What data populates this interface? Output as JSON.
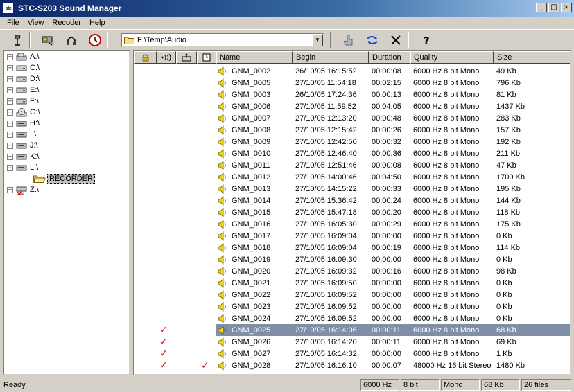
{
  "window": {
    "title": "STC-S203 Sound Manager",
    "icon_text": "stc"
  },
  "menu": [
    "File",
    "View",
    "Recoder",
    "Help"
  ],
  "toolbar": {
    "path": "F:\\Temp\\Audio"
  },
  "tree": [
    {
      "label": "A:\\",
      "icon": "floppy-drive-icon"
    },
    {
      "label": "C:\\",
      "icon": "hard-drive-icon"
    },
    {
      "label": "D:\\",
      "icon": "hard-drive-icon"
    },
    {
      "label": "E:\\",
      "icon": "hard-drive-icon"
    },
    {
      "label": "F:\\",
      "icon": "hard-drive-icon"
    },
    {
      "label": "G:\\",
      "icon": "cd-drive-icon"
    },
    {
      "label": "H:\\",
      "icon": "removable-drive-icon"
    },
    {
      "label": "I:\\",
      "icon": "removable-drive-icon"
    },
    {
      "label": "J:\\",
      "icon": "removable-drive-icon"
    },
    {
      "label": "K:\\",
      "icon": "removable-drive-icon"
    },
    {
      "label": "L:\\",
      "icon": "removable-drive-icon",
      "expanded": true
    },
    {
      "label": "RECORDER",
      "icon": "folder-open-icon",
      "child": true
    },
    {
      "label": "Z:\\",
      "icon": "network-drive-icon"
    }
  ],
  "columns": [
    "",
    "",
    "",
    "",
    "Name",
    "Begin",
    "Duration",
    "Quality",
    "Size"
  ],
  "files": [
    {
      "name": "GNM_0002",
      "begin": "26/10/05  16:15:52",
      "duration": "00:00:08",
      "quality": "6000 Hz 8 bit Mono",
      "size": "49 Kb",
      "c1": "",
      "c4": ""
    },
    {
      "name": "GNM_0005",
      "begin": "27/10/05  11:54:18",
      "duration": "00:02:15",
      "quality": "6000 Hz 8 bit Mono",
      "size": "796 Kb",
      "c1": "",
      "c4": ""
    },
    {
      "name": "GNM_0003",
      "begin": "26/10/05  17:24:36",
      "duration": "00:00:13",
      "quality": "6000 Hz 8 bit Mono",
      "size": "81 Kb",
      "c1": "",
      "c4": ""
    },
    {
      "name": "GNM_0006",
      "begin": "27/10/05  11:59:52",
      "duration": "00:04:05",
      "quality": "6000 Hz 8 bit Mono",
      "size": "1437 Kb",
      "c1": "",
      "c4": ""
    },
    {
      "name": "GNM_0007",
      "begin": "27/10/05  12:13:20",
      "duration": "00:00:48",
      "quality": "6000 Hz 8 bit Mono",
      "size": "283 Kb",
      "c1": "",
      "c4": ""
    },
    {
      "name": "GNM_0008",
      "begin": "27/10/05  12:15:42",
      "duration": "00:00:26",
      "quality": "6000 Hz 8 bit Mono",
      "size": "157 Kb",
      "c1": "",
      "c4": ""
    },
    {
      "name": "GNM_0009",
      "begin": "27/10/05  12:42:50",
      "duration": "00:00:32",
      "quality": "6000 Hz 8 bit Mono",
      "size": "192 Kb",
      "c1": "",
      "c4": ""
    },
    {
      "name": "GNM_0010",
      "begin": "27/10/05  12:46:40",
      "duration": "00:00:36",
      "quality": "6000 Hz 8 bit Mono",
      "size": "211 Kb",
      "c1": "",
      "c4": ""
    },
    {
      "name": "GNM_0011",
      "begin": "27/10/05  12:51:46",
      "duration": "00:00:08",
      "quality": "6000 Hz 8 bit Mono",
      "size": "47 Kb",
      "c1": "",
      "c4": ""
    },
    {
      "name": "GNM_0012",
      "begin": "27/10/05  14:00:46",
      "duration": "00:04:50",
      "quality": "6000 Hz 8 bit Mono",
      "size": "1700 Kb",
      "c1": "",
      "c4": ""
    },
    {
      "name": "GNM_0013",
      "begin": "27/10/05  14:15:22",
      "duration": "00:00:33",
      "quality": "6000 Hz 8 bit Mono",
      "size": "195 Kb",
      "c1": "",
      "c4": ""
    },
    {
      "name": "GNM_0014",
      "begin": "27/10/05  15:36:42",
      "duration": "00:00:24",
      "quality": "6000 Hz 8 bit Mono",
      "size": "144 Kb",
      "c1": "",
      "c4": ""
    },
    {
      "name": "GNM_0015",
      "begin": "27/10/05  15:47:18",
      "duration": "00:00:20",
      "quality": "6000 Hz 8 bit Mono",
      "size": "118 Kb",
      "c1": "",
      "c4": ""
    },
    {
      "name": "GNM_0016",
      "begin": "27/10/05  16:05:30",
      "duration": "00:00:29",
      "quality": "6000 Hz 8 bit Mono",
      "size": "175 Kb",
      "c1": "",
      "c4": ""
    },
    {
      "name": "GNM_0017",
      "begin": "27/10/05  16:09:04",
      "duration": "00:00:00",
      "quality": "6000 Hz 8 bit Mono",
      "size": "0 Kb",
      "c1": "",
      "c4": ""
    },
    {
      "name": "GNM_0018",
      "begin": "27/10/05  16:09:04",
      "duration": "00:00:19",
      "quality": "6000 Hz 8 bit Mono",
      "size": "114 Kb",
      "c1": "",
      "c4": ""
    },
    {
      "name": "GNM_0019",
      "begin": "27/10/05  16:09:30",
      "duration": "00:00:00",
      "quality": "6000 Hz 8 bit Mono",
      "size": "0 Kb",
      "c1": "",
      "c4": ""
    },
    {
      "name": "GNM_0020",
      "begin": "27/10/05  16:09:32",
      "duration": "00:00:16",
      "quality": "6000 Hz 8 bit Mono",
      "size": "98 Kb",
      "c1": "",
      "c4": ""
    },
    {
      "name": "GNM_0021",
      "begin": "27/10/05  16:09:50",
      "duration": "00:00:00",
      "quality": "6000 Hz 8 bit Mono",
      "size": "0 Kb",
      "c1": "",
      "c4": ""
    },
    {
      "name": "GNM_0022",
      "begin": "27/10/05  16:09:52",
      "duration": "00:00:00",
      "quality": "6000 Hz 8 bit Mono",
      "size": "0 Kb",
      "c1": "",
      "c4": ""
    },
    {
      "name": "GNM_0023",
      "begin": "27/10/05  16:09:52",
      "duration": "00:00:00",
      "quality": "6000 Hz 8 bit Mono",
      "size": "0 Kb",
      "c1": "",
      "c4": ""
    },
    {
      "name": "GNM_0024",
      "begin": "27/10/05  16:09:52",
      "duration": "00:00:00",
      "quality": "6000 Hz 8 bit Mono",
      "size": "0 Kb",
      "c1": "",
      "c4": ""
    },
    {
      "name": "GNM_0025",
      "begin": "27/10/05  16:14:06",
      "duration": "00:00:11",
      "quality": "6000 Hz 8 bit Mono",
      "size": "68 Kb",
      "c1": "✓",
      "c4": "",
      "selected": true
    },
    {
      "name": "GNM_0026",
      "begin": "27/10/05  16:14:20",
      "duration": "00:00:11",
      "quality": "6000 Hz 8 bit Mono",
      "size": "69 Kb",
      "c1": "✓",
      "c4": ""
    },
    {
      "name": "GNM_0027",
      "begin": "27/10/05  16:14:32",
      "duration": "00:00:00",
      "quality": "6000 Hz 8 bit Mono",
      "size": "1 Kb",
      "c1": "✓",
      "c4": ""
    },
    {
      "name": "GNM_0028",
      "begin": "27/10/05  16:16:10",
      "duration": "00:00:07",
      "quality": "48000 Hz 16 bit Stereo",
      "size": "1480 Kb",
      "c1": "✓",
      "c4": "✓"
    }
  ],
  "status": {
    "text": "Ready",
    "rate": "6000 Hz",
    "bits": "8 bit",
    "channels": "Mono",
    "size": "68 Kb",
    "count": "26 files"
  },
  "colors": {
    "selection": "#7f8fa6",
    "check": "#e00000",
    "title_start": "#0a246a"
  }
}
